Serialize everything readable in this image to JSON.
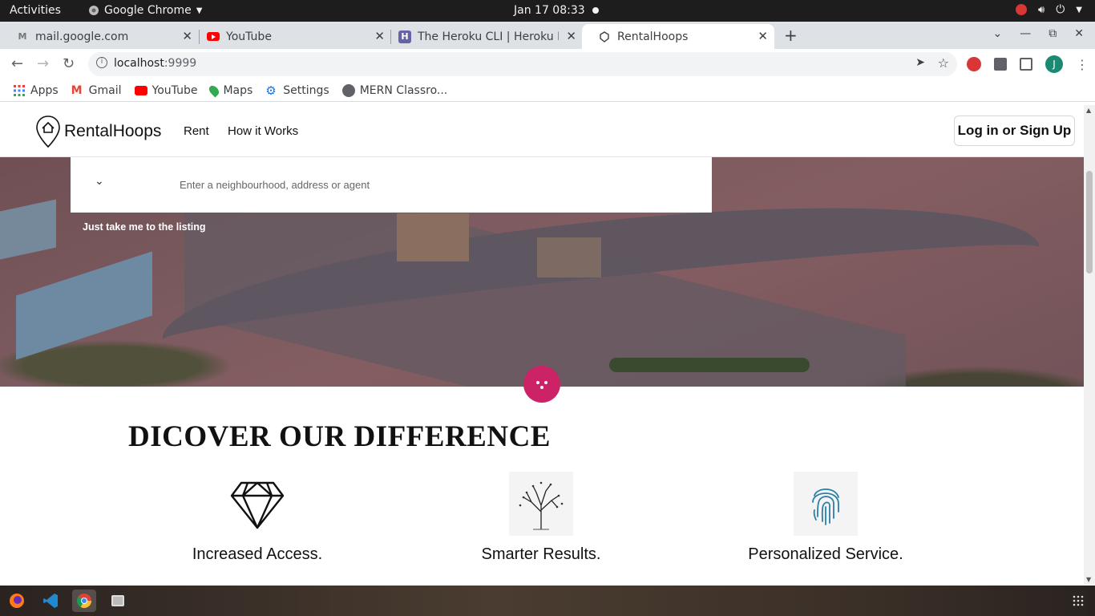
{
  "system": {
    "activities": "Activities",
    "app_name": "Google Chrome",
    "clock": "Jan 17  08:33"
  },
  "tabs": [
    {
      "title": "mail.google.com",
      "icon": "gmail-icon"
    },
    {
      "title": "YouTube",
      "icon": "youtube-icon"
    },
    {
      "title": "The Heroku CLI | Heroku D",
      "icon": "heroku-icon"
    },
    {
      "title": "RentalHoops",
      "icon": "rentalhoops-icon",
      "active": true
    }
  ],
  "omnibox": {
    "host": "localhost",
    "port": ":9999"
  },
  "profile": {
    "initial": "J"
  },
  "bookmarks": [
    {
      "label": "Apps",
      "icon": "apps-grid-icon"
    },
    {
      "label": "Gmail",
      "icon": "gmail-icon"
    },
    {
      "label": "YouTube",
      "icon": "youtube-icon"
    },
    {
      "label": "Maps",
      "icon": "maps-pin-icon"
    },
    {
      "label": "Settings",
      "icon": "gear-icon"
    },
    {
      "label": "MERN Classro...",
      "icon": "globe-icon"
    }
  ],
  "site": {
    "brand": "RentalHoops",
    "nav": [
      "Rent",
      "How it Works"
    ],
    "login": "Log in or Sign Up",
    "search_placeholder": "Enter a neighbourhood, address or agent",
    "listing_link": "Just take me to the listing",
    "section_title": "DICOVER OUR DIFFERENCE",
    "features": [
      {
        "label": "Increased Access.",
        "icon": "diamond-icon"
      },
      {
        "label": "Smarter Results.",
        "icon": "tree-icon"
      },
      {
        "label": "Personalized Service.",
        "icon": "fingerprint-icon"
      }
    ]
  },
  "colors": {
    "accent": "#cc2367",
    "topbar": "#1d1d1d",
    "tabstrip": "#dee1e6"
  },
  "taskbar": [
    {
      "name": "firefox-icon"
    },
    {
      "name": "vscode-icon"
    },
    {
      "name": "chrome-icon",
      "active": true
    },
    {
      "name": "files-icon"
    }
  ]
}
